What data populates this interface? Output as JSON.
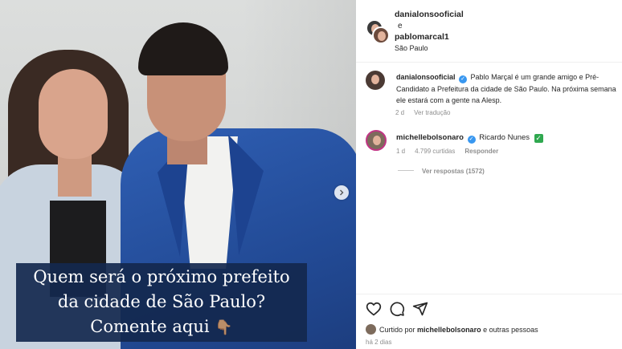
{
  "post": {
    "caption_overlay": [
      "Quem será o próximo prefeito",
      "da cidade de São Paulo?",
      "Comente aqui"
    ],
    "caption_emoji": "👇🏽"
  },
  "header": {
    "user1": "danialonsooficial",
    "conjunction": "e",
    "user2": "pablomarcal1",
    "location": "São Paulo"
  },
  "caption": {
    "username": "danialonsooficial",
    "text": "Pablo Marçal é um grande amigo e Pré-Candidato a Prefeitura da cidade de São Paulo. Na próxima semana ele estará com a gente na Alesp.",
    "age": "2 d",
    "translate": "Ver tradução"
  },
  "comment": {
    "username": "michellebolsonaro",
    "text": "Ricardo Nunes",
    "check": "✓",
    "age": "1 d",
    "likes": "4.799 curtidas",
    "reply": "Responder",
    "view_replies": "Ver respostas (1572)"
  },
  "footer": {
    "liked_by_prefix": "Curtido por",
    "liked_by_user": "michellebolsonaro",
    "liked_by_suffix": "e outras pessoas",
    "time": "há 2 dias"
  },
  "icons": [
    "heart-icon",
    "comment-icon",
    "share-icon",
    "chevron-right-icon",
    "verified-icon",
    "check-mark-icon"
  ],
  "colors": {
    "verified": "#3897f0",
    "check": "#2fa84f",
    "caption_bg": "#14284e",
    "suit": "#2f5fb4"
  }
}
